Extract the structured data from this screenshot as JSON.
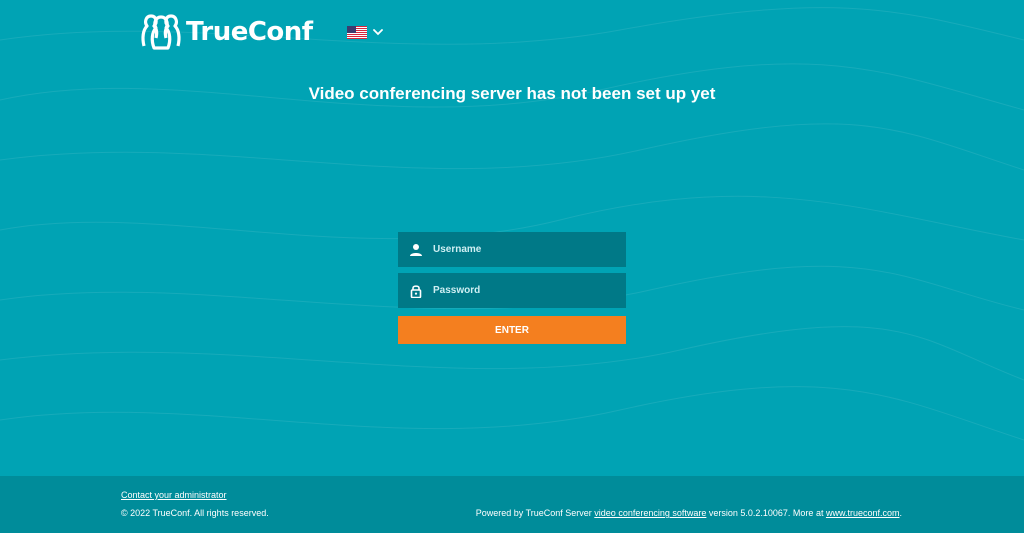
{
  "brand": {
    "name": "TrueConf"
  },
  "language": {
    "flag_icon": "us-flag-icon",
    "current": "English"
  },
  "title": "Video conferencing server has not been set up yet",
  "login": {
    "username_placeholder": "Username",
    "password_placeholder": "Password",
    "enter_label": "ENTER"
  },
  "footer": {
    "contact_label": "Contact your administrator",
    "copyright": "© 2022 TrueConf. All rights reserved.",
    "powered_prefix": "Powered by TrueConf Server ",
    "powered_link": "video conferencing software",
    "version_text": " version 5.0.2.10067. More at ",
    "site_link": "www.trueconf.com",
    "suffix": "."
  },
  "colors": {
    "background": "#00a3b4",
    "field": "#007987",
    "button": "#f47f1f",
    "footer": "#008c9a"
  }
}
